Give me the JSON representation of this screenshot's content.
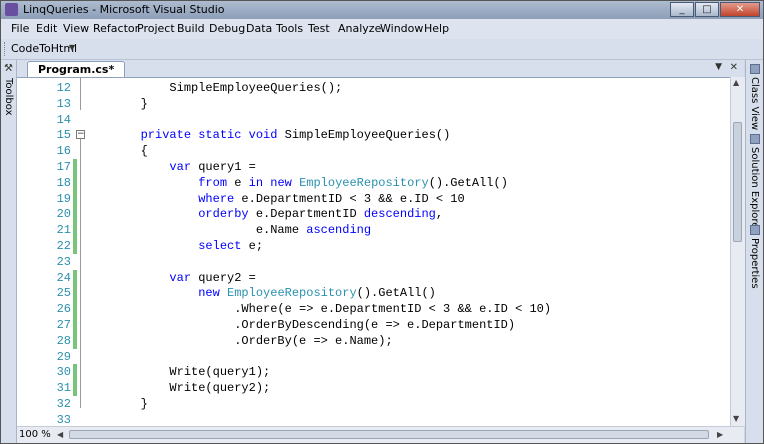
{
  "window": {
    "title": "LinqQueries - Microsoft Visual Studio"
  },
  "menu": [
    "File",
    "Edit",
    "View",
    "Refactor",
    "Project",
    "Build",
    "Debug",
    "Data",
    "Tools",
    "Test",
    "Analyze",
    "Window",
    "Help"
  ],
  "toolbar": {
    "button_label": "CodeToHtml"
  },
  "side_tabs": {
    "left": "Toolbox",
    "right": [
      "Class View",
      "Solution Explorer",
      "Properties"
    ]
  },
  "document_tab": {
    "label": "Program.cs*"
  },
  "editor": {
    "zoom": "100 %",
    "lines": [
      {
        "n": "12",
        "tokens": [
          {
            "t": "            SimpleEmployeeQueries();"
          }
        ]
      },
      {
        "n": "13",
        "tokens": [
          {
            "t": "        }"
          }
        ]
      },
      {
        "n": "14",
        "tokens": []
      },
      {
        "n": "15",
        "tokens": [
          {
            "t": "        "
          },
          {
            "t": "private",
            "c": "kw"
          },
          {
            "t": " "
          },
          {
            "t": "static",
            "c": "kw"
          },
          {
            "t": " "
          },
          {
            "t": "void",
            "c": "kw"
          },
          {
            "t": " SimpleEmployeeQueries()"
          }
        ]
      },
      {
        "n": "16",
        "tokens": [
          {
            "t": "        {"
          }
        ]
      },
      {
        "n": "17",
        "tokens": [
          {
            "t": "            "
          },
          {
            "t": "var",
            "c": "kw"
          },
          {
            "t": " query1 ="
          }
        ]
      },
      {
        "n": "18",
        "tokens": [
          {
            "t": "                "
          },
          {
            "t": "from",
            "c": "kw"
          },
          {
            "t": " e "
          },
          {
            "t": "in",
            "c": "kw"
          },
          {
            "t": " "
          },
          {
            "t": "new",
            "c": "kw"
          },
          {
            "t": " "
          },
          {
            "t": "EmployeeRepository",
            "c": "ty"
          },
          {
            "t": "().GetAll()"
          }
        ]
      },
      {
        "n": "19",
        "tokens": [
          {
            "t": "                "
          },
          {
            "t": "where",
            "c": "kw"
          },
          {
            "t": " e.DepartmentID < 3 && e.ID < 10"
          }
        ]
      },
      {
        "n": "20",
        "tokens": [
          {
            "t": "                "
          },
          {
            "t": "orderby",
            "c": "kw"
          },
          {
            "t": " e.DepartmentID "
          },
          {
            "t": "descending",
            "c": "kw"
          },
          {
            "t": ","
          }
        ]
      },
      {
        "n": "21",
        "tokens": [
          {
            "t": "                        e.Name "
          },
          {
            "t": "ascending",
            "c": "kw"
          }
        ]
      },
      {
        "n": "22",
        "tokens": [
          {
            "t": "                "
          },
          {
            "t": "select",
            "c": "kw"
          },
          {
            "t": " e;"
          }
        ]
      },
      {
        "n": "23",
        "tokens": []
      },
      {
        "n": "24",
        "tokens": [
          {
            "t": "            "
          },
          {
            "t": "var",
            "c": "kw"
          },
          {
            "t": " query2 ="
          }
        ]
      },
      {
        "n": "25",
        "tokens": [
          {
            "t": "                "
          },
          {
            "t": "new",
            "c": "kw"
          },
          {
            "t": " "
          },
          {
            "t": "EmployeeRepository",
            "c": "ty"
          },
          {
            "t": "().GetAll()"
          }
        ]
      },
      {
        "n": "26",
        "tokens": [
          {
            "t": "                     .Where(e => e.DepartmentID < 3 && e.ID < 10)"
          }
        ]
      },
      {
        "n": "27",
        "tokens": [
          {
            "t": "                     .OrderByDescending(e => e.DepartmentID)"
          }
        ]
      },
      {
        "n": "28",
        "tokens": [
          {
            "t": "                     .OrderBy(e => e.Name);"
          }
        ]
      },
      {
        "n": "29",
        "tokens": []
      },
      {
        "n": "30",
        "tokens": [
          {
            "t": "            Write(query1);"
          }
        ]
      },
      {
        "n": "31",
        "tokens": [
          {
            "t": "            Write(query2);"
          }
        ]
      },
      {
        "n": "32",
        "tokens": [
          {
            "t": "        }"
          }
        ]
      },
      {
        "n": "33",
        "tokens": []
      }
    ]
  }
}
